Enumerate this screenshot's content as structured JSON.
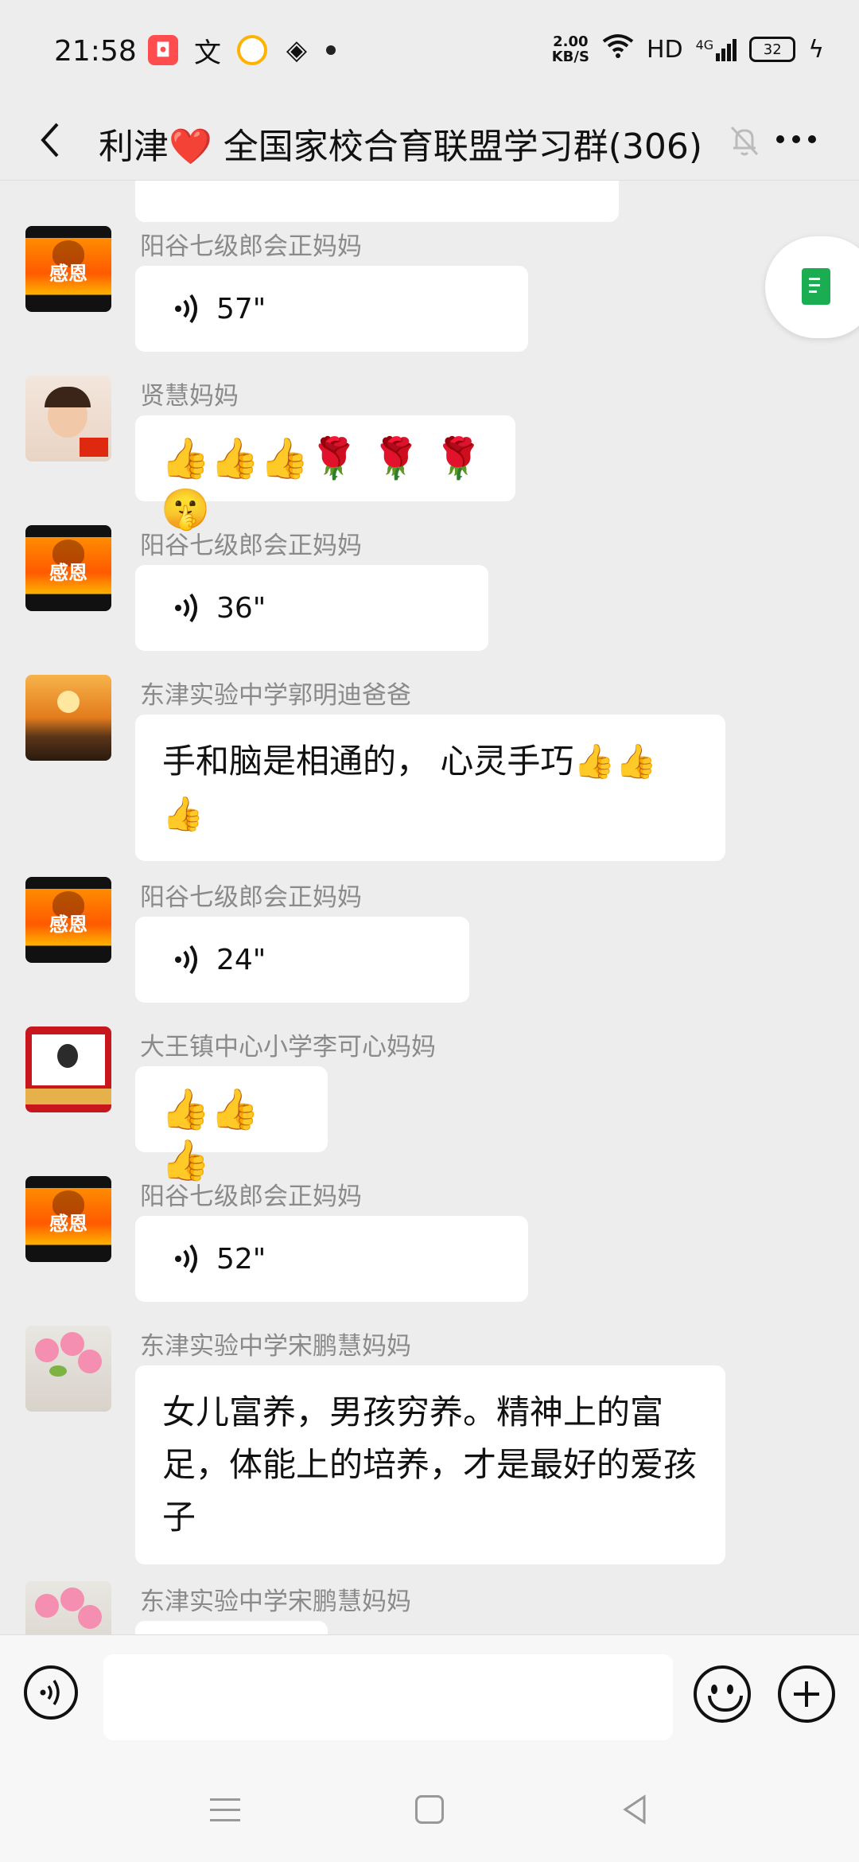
{
  "status_bar": {
    "time": "21:58",
    "net_speed_value": "2.00",
    "net_speed_unit": "KB/S",
    "hd": "HD",
    "network": "4G",
    "battery": "32"
  },
  "header": {
    "title": "利津❤️ 全国家校合育联盟学习群(306)"
  },
  "messages": [
    {
      "sender": "阳谷七级郎会正妈妈",
      "type": "voice",
      "duration": "57\""
    },
    {
      "sender": "贤慧妈妈",
      "type": "emoji",
      "text": "👍👍👍🌹 🌹 🌹🤫"
    },
    {
      "sender": "阳谷七级郎会正妈妈",
      "type": "voice",
      "duration": "36\""
    },
    {
      "sender": "东津实验中学郭明迪爸爸",
      "type": "text",
      "text": "手和脑是相通的， 心灵手巧👍👍👍"
    },
    {
      "sender": "阳谷七级郎会正妈妈",
      "type": "voice",
      "duration": "24\""
    },
    {
      "sender": "大王镇中心小学李可心妈妈",
      "type": "emoji",
      "text": "👍👍👍"
    },
    {
      "sender": "阳谷七级郎会正妈妈",
      "type": "voice",
      "duration": "52\""
    },
    {
      "sender": "东津实验中学宋鹏慧妈妈",
      "type": "text",
      "text": "女儿富养，男孩穷养。精神上的富足，体能上的培养，才是最好的爱孩子"
    },
    {
      "sender": "东津实验中学宋鹏慧妈妈",
      "type": "partial"
    }
  ],
  "avatar_labels": {
    "gratitude": "感恩"
  },
  "colors": {
    "background": "#ededed",
    "bubble": "#ffffff",
    "accent_green": "#1aad52"
  }
}
